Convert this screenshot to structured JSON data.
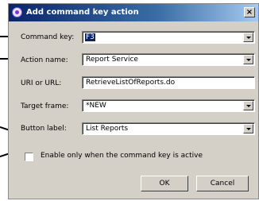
{
  "dialog": {
    "title": "Add command key action",
    "close_label": "×"
  },
  "fields": {
    "command_key": {
      "label": "Command key:",
      "value": "F3"
    },
    "action_name": {
      "label": "Action name:",
      "value": "Report Service"
    },
    "uri": {
      "label": "URI or URL:",
      "value": "RetrieveListOfReports.do"
    },
    "target_frame": {
      "label": "Target frame:",
      "value": "*NEW"
    },
    "button_label": {
      "label": "Button label:",
      "value": "List Reports"
    }
  },
  "checkbox": {
    "label": "Enable only when the command key is active",
    "checked": false
  },
  "buttons": {
    "ok": "OK",
    "cancel": "Cancel"
  }
}
